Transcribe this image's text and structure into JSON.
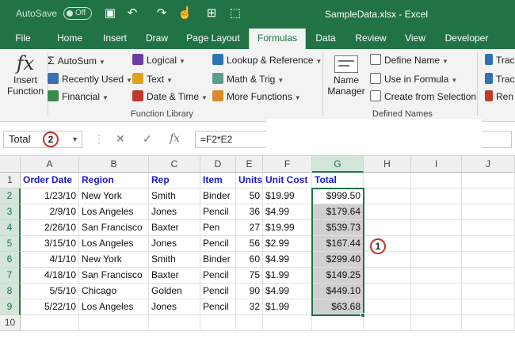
{
  "titlebar": {
    "autosave_label": "AutoSave",
    "autosave_state": "Off",
    "title": "SampleData.xlsx  -  Excel"
  },
  "tabs": [
    "File",
    "Home",
    "Insert",
    "Draw",
    "Page Layout",
    "Formulas",
    "Data",
    "Review",
    "View",
    "Developer"
  ],
  "ribbon": {
    "insert_function": [
      "Insert",
      "Function"
    ],
    "insert_function_icon_text": "fx",
    "function_library": {
      "autosum": "AutoSum",
      "recently_used": "Recently Used",
      "financial": "Financial",
      "logical": "Logical",
      "text": "Text",
      "date_time": "Date & Time",
      "lookup": "Lookup & Reference",
      "math_trig": "Math & Trig",
      "more_functions": "More Functions",
      "group_label": "Function Library"
    },
    "defined_names": {
      "name_manager": [
        "Name",
        "Manager"
      ],
      "define_name": "Define Name",
      "use_in_formula": "Use in Formula",
      "create_from_selection": "Create from Selection",
      "group_label": "Defined Names"
    },
    "auditing": {
      "trace_precedents": "Trac",
      "trace_dependents": "Trac",
      "remove_arrows": "Ren"
    }
  },
  "formula_bar": {
    "name_box": "Total",
    "formula": "=F2*E2",
    "cancel_symbol": "✕",
    "enter_symbol": "✓",
    "fx_symbol": "fx"
  },
  "annotations": {
    "badge_1": "1",
    "badge_2": "2"
  },
  "columns": [
    "A",
    "B",
    "C",
    "D",
    "E",
    "F",
    "G",
    "H",
    "I",
    "J"
  ],
  "rows": [
    "1",
    "2",
    "3",
    "4",
    "5",
    "6",
    "7",
    "8",
    "9",
    "10"
  ],
  "table": {
    "headers": [
      "Order Date",
      "Region",
      "Rep",
      "Item",
      "Units",
      "Unit Cost",
      "Total"
    ],
    "data": [
      [
        "1/23/10",
        "New York",
        "Smith",
        "Binder",
        "50",
        "$19.99",
        "$999.50"
      ],
      [
        "2/9/10",
        "Los Angeles",
        "Jones",
        "Pencil",
        "36",
        "$4.99",
        "$179.64"
      ],
      [
        "2/26/10",
        "San Francisco",
        "Baxter",
        "Pen",
        "27",
        "$19.99",
        "$539.73"
      ],
      [
        "3/15/10",
        "Los Angeles",
        "Jones",
        "Pencil",
        "56",
        "$2.99",
        "$167.44"
      ],
      [
        "4/1/10",
        "New York",
        "Smith",
        "Binder",
        "60",
        "$4.99",
        "$299.40"
      ],
      [
        "4/18/10",
        "San Francisco",
        "Baxter",
        "Pencil",
        "75",
        "$1.99",
        "$149.25"
      ],
      [
        "5/5/10",
        "Chicago",
        "Golden",
        "Pencil",
        "90",
        "$4.99",
        "$449.10"
      ],
      [
        "5/22/10",
        "Los Angeles",
        "Jones",
        "Pencil",
        "32",
        "$1.99",
        "$63.68"
      ]
    ]
  },
  "colors": {
    "accent": "#217346",
    "header_text": "#1a1ad0",
    "badge_ring": "#c0392b"
  }
}
